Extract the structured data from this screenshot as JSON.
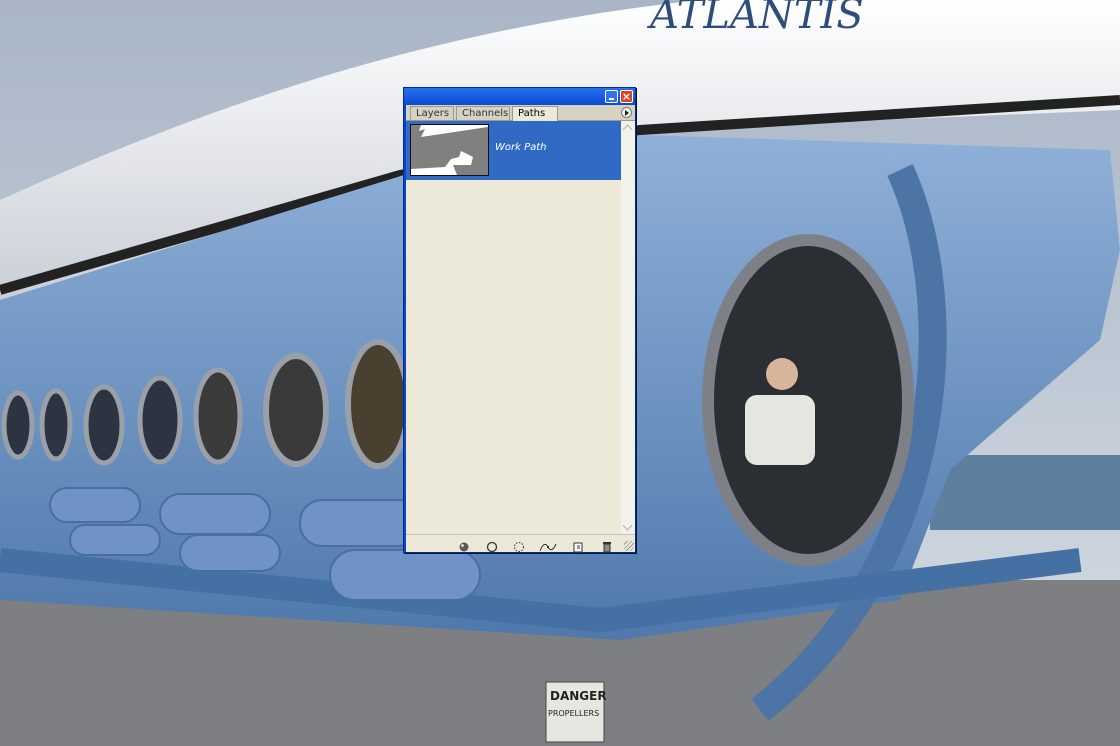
{
  "palette": {
    "tabs": [
      "Layers",
      "Channels",
      "Paths"
    ],
    "active_tab": "Paths",
    "paths": [
      {
        "name": "Work Path",
        "selected": true
      }
    ],
    "bottom_tools": [
      "fill-path-icon",
      "stroke-path-icon",
      "load-path-as-selection-icon",
      "make-work-path-icon",
      "new-path-icon",
      "delete-path-icon"
    ]
  },
  "background": {
    "sign_text": [
      "DANGER",
      "PROPELLERS"
    ],
    "hull_lettering": "ATLANTIS"
  },
  "colors": {
    "titlebar": "#0a46c9",
    "selection": "#316ac5",
    "panel": "#ece9d8",
    "close_button": "#d8481f",
    "hull_blue": "#5b85b8"
  }
}
